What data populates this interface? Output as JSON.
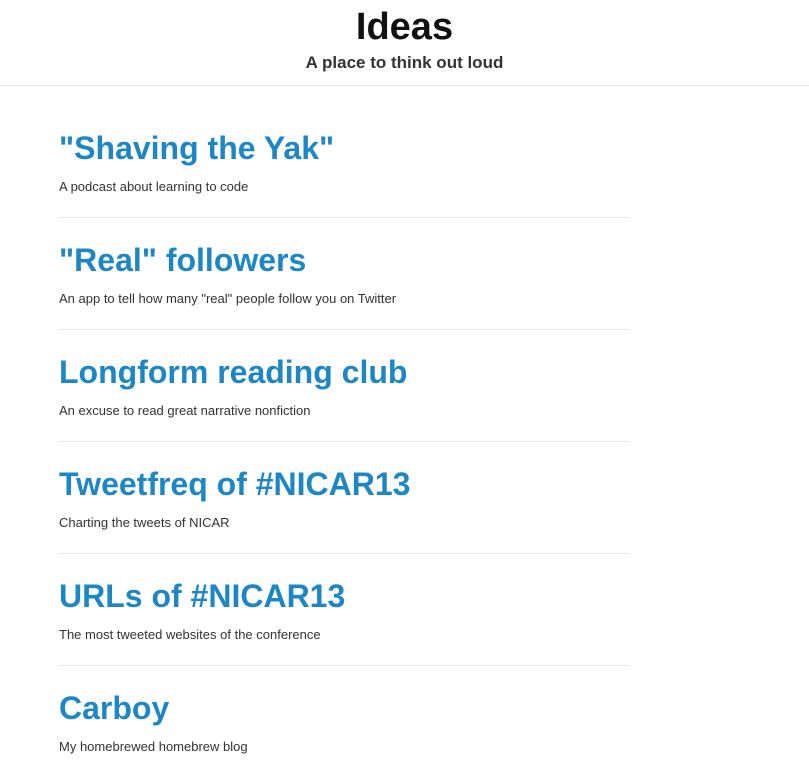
{
  "header": {
    "title": "Ideas",
    "subtitle": "A place to think out loud"
  },
  "ideas": [
    {
      "title": "\"Shaving the Yak\"",
      "description": "A podcast about learning to code"
    },
    {
      "title": "\"Real\" followers",
      "description": "An app to tell how many \"real\" people follow you on Twitter"
    },
    {
      "title": "Longform reading club",
      "description": "An excuse to read great narrative nonfiction"
    },
    {
      "title": "Tweetfreq of #NICAR13",
      "description": "Charting the tweets of NICAR"
    },
    {
      "title": "URLs of #NICAR13",
      "description": "The most tweeted websites of the conference"
    },
    {
      "title": "Carboy",
      "description": "My homebrewed homebrew blog"
    }
  ]
}
